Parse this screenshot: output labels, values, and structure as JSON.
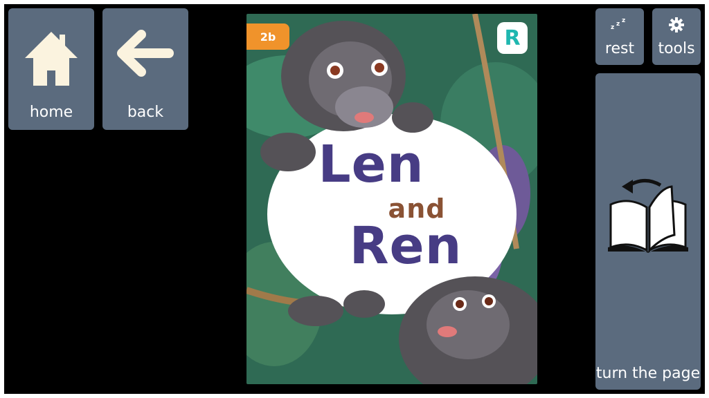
{
  "toolbar": {
    "home_label": "home",
    "back_label": "back",
    "rest_label": "rest",
    "tools_label": "tools",
    "turn_page_label": "turn the page",
    "icons": {
      "home": "home-icon",
      "back": "arrow-left-icon",
      "rest": "sleep-zzz-icon",
      "tools": "gear-icon",
      "turn_page": "book-page-turn-icon"
    }
  },
  "book": {
    "level": "2b",
    "brand_mark": "R",
    "title_line_1": "Len",
    "title_line_2": "and",
    "title_line_3": "Ren"
  },
  "colors": {
    "button_bg": "#5b6b7e",
    "icon_cream": "#fbf3df",
    "background": "#000000",
    "title_purple": "#473c84",
    "title_brown": "#8a5234",
    "badge_orange": "#f0932b",
    "brand_teal": "#1fb7b0"
  }
}
